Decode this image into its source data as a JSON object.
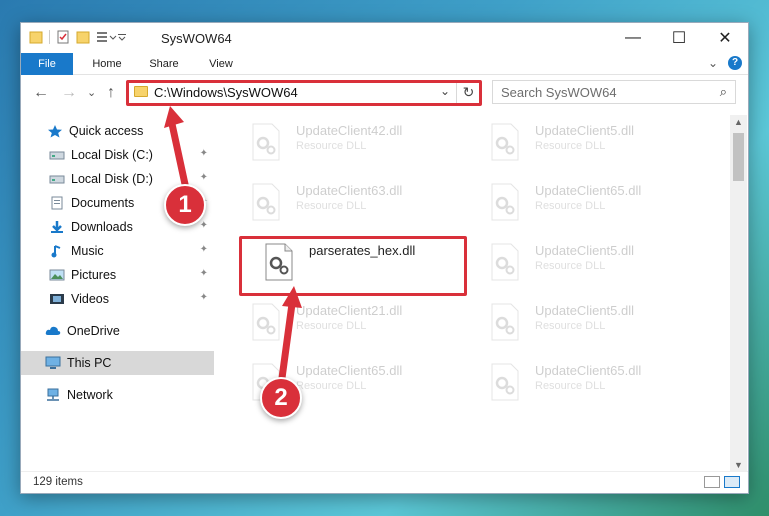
{
  "window": {
    "title": "SysWOW64",
    "controls": {
      "minimize": "—",
      "maximize": "☐",
      "close": "✕"
    }
  },
  "ribbon": {
    "tabs": [
      "File",
      "Home",
      "Share",
      "View"
    ],
    "collapse": "⌄",
    "help": "?"
  },
  "nav": {
    "back": "←",
    "forward": "→",
    "recent": "⌄",
    "up": "↑",
    "address": "C:\\Windows\\SysWOW64",
    "address_dropdown": "⌄",
    "refresh": "↻",
    "search_placeholder": "Search SysWOW64",
    "search_icon": "⌕"
  },
  "sidebar": {
    "items": [
      {
        "label": "Quick access",
        "icon": "star-icon"
      },
      {
        "label": "Local Disk (C:)",
        "icon": "drive-icon",
        "pinned": true
      },
      {
        "label": "Local Disk (D:)",
        "icon": "drive-icon",
        "pinned": true
      },
      {
        "label": "Documents",
        "icon": "documents-icon",
        "pinned": true
      },
      {
        "label": "Downloads",
        "icon": "download-icon",
        "pinned": true
      },
      {
        "label": "Music",
        "icon": "music-icon",
        "pinned": true
      },
      {
        "label": "Pictures",
        "icon": "pictures-icon",
        "pinned": true
      },
      {
        "label": "Videos",
        "icon": "videos-icon",
        "pinned": true
      },
      {
        "label": "OneDrive",
        "icon": "cloud-icon"
      },
      {
        "label": "This PC",
        "icon": "computer-icon",
        "selected": true
      },
      {
        "label": "Network",
        "icon": "network-icon"
      }
    ],
    "pin_glyph": "📌"
  },
  "files": {
    "left": [
      {
        "name": "UpdateClient42.dll",
        "type": "Resource DLL"
      },
      {
        "name": "UpdateClient63.dll",
        "type": "Resource DLL"
      },
      {
        "name": "parserates_hex.dll",
        "type": ""
      },
      {
        "name": "UpdateClient21.dll",
        "type": "Resource DLL"
      },
      {
        "name": "UpdateClient65.dll",
        "type": "Resource DLL"
      }
    ],
    "right": [
      {
        "name": "UpdateClient5.dll",
        "type": "Resource DLL"
      },
      {
        "name": "UpdateClient65.dll",
        "type": "Resource DLL"
      },
      {
        "name": "UpdateClient5.dll",
        "type": "Resource DLL"
      },
      {
        "name": "UpdateClient5.dll",
        "type": "Resource DLL"
      },
      {
        "name": "UpdateClient65.dll",
        "type": "Resource DLL"
      }
    ]
  },
  "annotations": {
    "step1": "1",
    "step2": "2"
  },
  "status": {
    "item_count": "129 items"
  },
  "colors": {
    "accent": "#1979ca",
    "highlight": "#d9303a"
  }
}
